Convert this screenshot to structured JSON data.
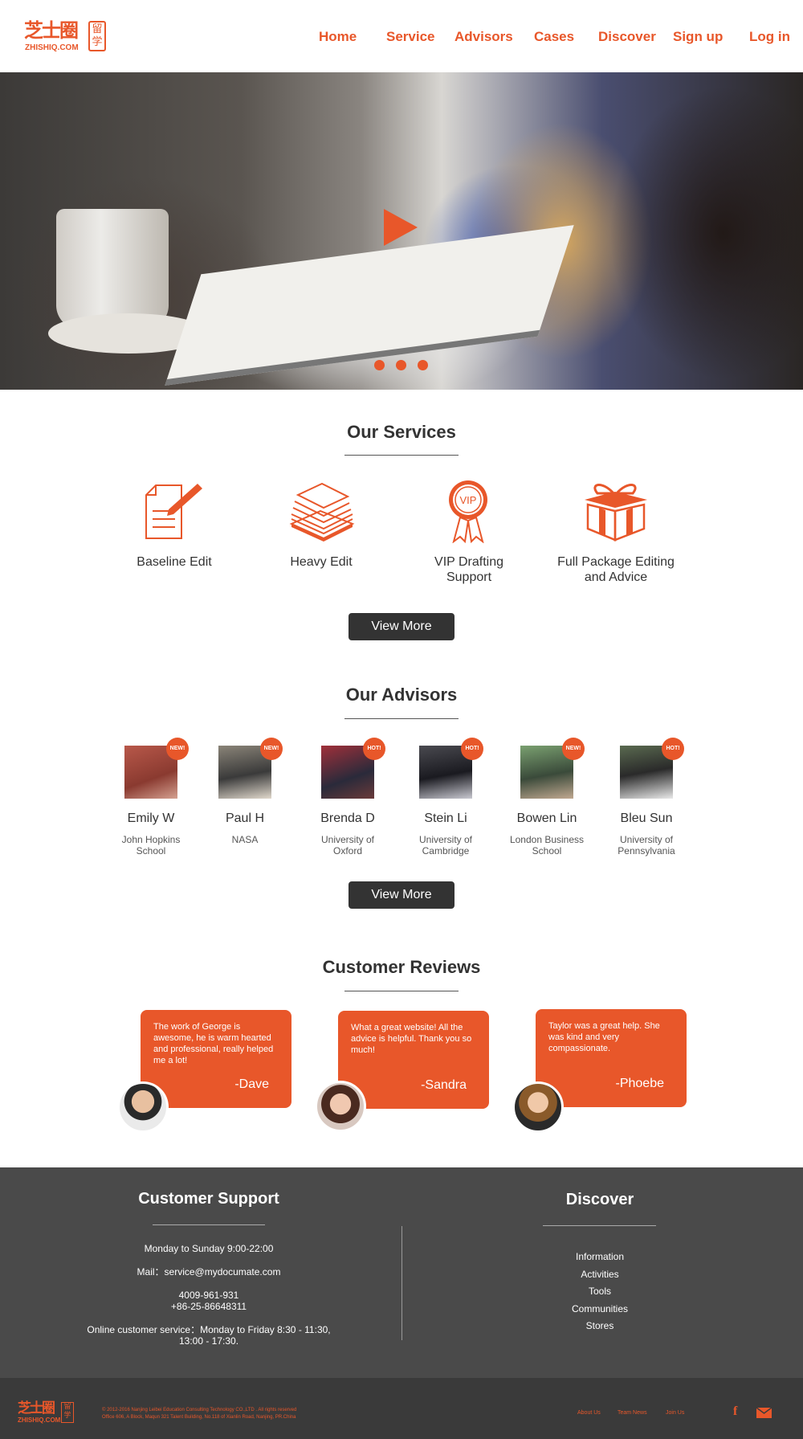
{
  "brand": {
    "logo_cn": "芝士圈",
    "logo_en": "ZHISHIQ.COM",
    "seal": "留学"
  },
  "nav": {
    "items": [
      "Home",
      "Service",
      "Advisors",
      "Cases",
      "Discover",
      "Sign up",
      "Log in"
    ]
  },
  "hero": {
    "slides": 3,
    "active": 1
  },
  "services": {
    "title": "Our Services",
    "items": [
      {
        "label": "Baseline Edit",
        "icon": "document-pencil-icon"
      },
      {
        "label": "Heavy Edit",
        "icon": "paper-stack-icon"
      },
      {
        "label": "VIP Drafting Support",
        "icon": "vip-ribbon-icon",
        "icon_text": "VIP"
      },
      {
        "label": "Full Package Editing and Advice",
        "icon": "gift-box-icon"
      }
    ],
    "button": "View More"
  },
  "advisors": {
    "title": "Our Advisors",
    "items": [
      {
        "name": "Emily W",
        "org": "John Hopkins School",
        "badge": "NEW!"
      },
      {
        "name": "Paul H",
        "org": "NASA",
        "badge": "NEW!"
      },
      {
        "name": "Brenda D",
        "org": "University of Oxford",
        "badge": "HOT!"
      },
      {
        "name": "Stein Li",
        "org": "University of Cambridge",
        "badge": "HOT!"
      },
      {
        "name": "Bowen Lin",
        "org": "London Business School",
        "badge": "NEW!"
      },
      {
        "name": "Bleu Sun",
        "org": "University of Pennsylvania",
        "badge": "HOT!"
      }
    ],
    "button": "View More"
  },
  "reviews": {
    "title": "Customer Reviews",
    "items": [
      {
        "text": "The work of George is awesome, he is warm hearted and professional, really helped me a lot!",
        "author": "-Dave"
      },
      {
        "text": "What a great website! All the advice is helpful. Thank you so much!",
        "author": "-Sandra"
      },
      {
        "text": "Taylor was a great help. She was kind and very compassionate.",
        "author": "-Phoebe"
      }
    ]
  },
  "footer": {
    "support": {
      "title": "Customer Support",
      "hours": "Monday to Sunday 9:00-22:00",
      "mail": "Mail：service@mydocumate.com",
      "phone1": "4009-961-931",
      "phone2": "+86-25-86648311",
      "online1": "Online customer service：Monday to Friday 8:30 - 11:30,",
      "online2": "13:00 - 17:30."
    },
    "discover": {
      "title": "Discover",
      "items": [
        "Information",
        "Activities",
        "Tools",
        "Communities",
        "Stores"
      ]
    }
  },
  "bottom": {
    "copyright1": "© 2012-2016 Nanjing Leibei Education Consulting Technology CO.,LTD . All rights reserved",
    "copyright2": "Office 606, A Block, Maqun 321 Talent Building, No.118 of Xianlin Road, Nanjing, PR.China",
    "links": [
      "About Us",
      "Team News",
      "Join Us"
    ],
    "social": [
      "facebook-icon",
      "mail-icon"
    ]
  },
  "colors": {
    "accent": "#e8572a",
    "dark": "#333333",
    "footer": "#4a4a4a",
    "bottom": "#3a3a3a"
  }
}
